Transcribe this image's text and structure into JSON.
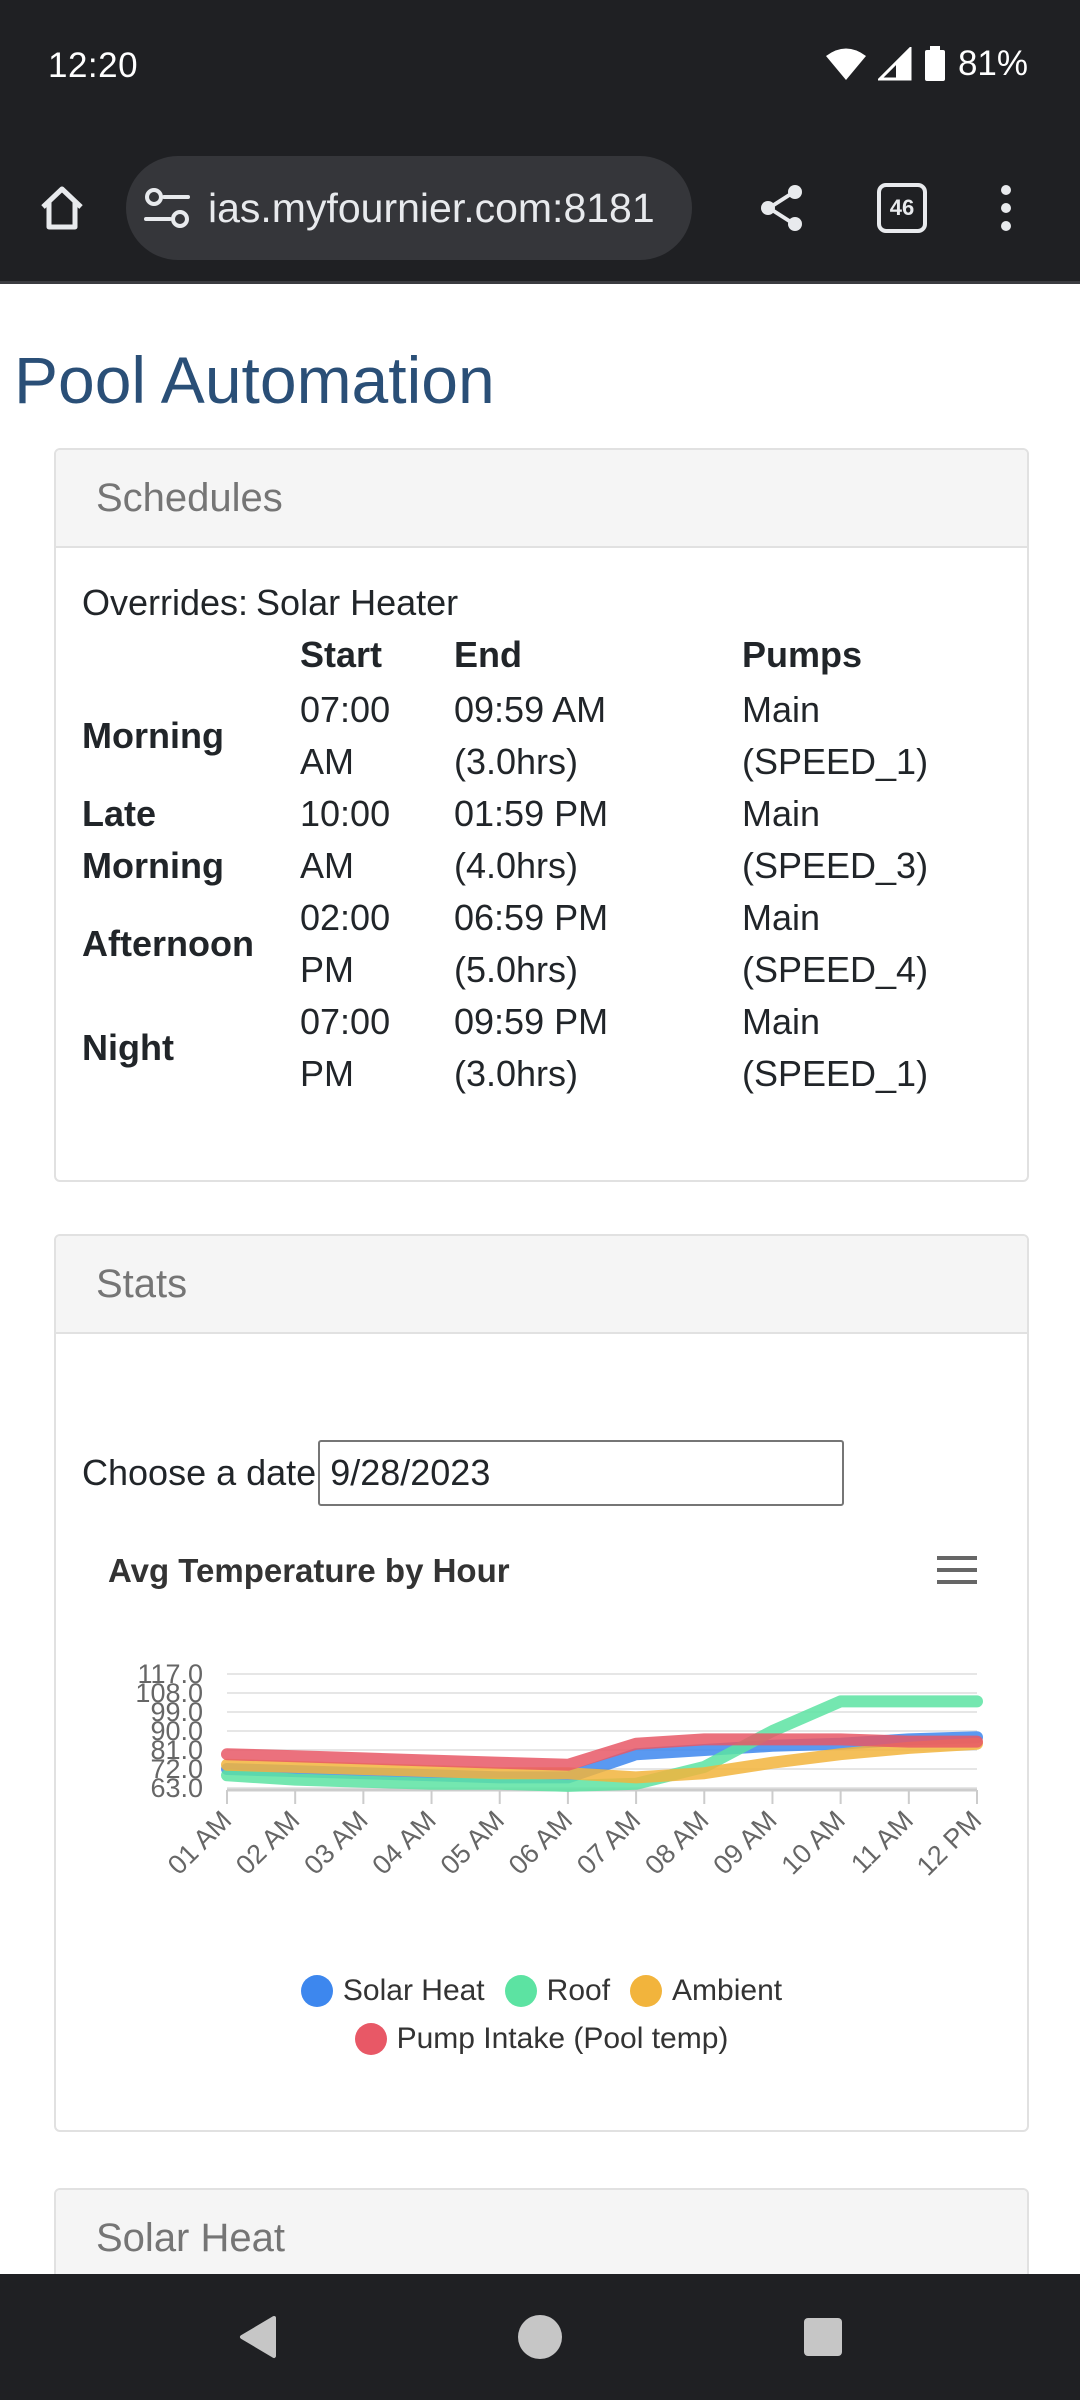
{
  "status": {
    "time": "12:20",
    "battery": "81%"
  },
  "browser": {
    "url": "ias.myfournier.com:8181",
    "tab_count": "46"
  },
  "page": {
    "title": "Pool Automation"
  },
  "schedules": {
    "header": "Schedules",
    "overrides_label": "Overrides:",
    "overrides_value": "Solar Heater",
    "columns": [
      "",
      "Start",
      "End",
      "Pumps"
    ],
    "rows": [
      {
        "name": "Morning",
        "start": [
          "07:00",
          "AM"
        ],
        "end": [
          "09:59 AM",
          "(3.0hrs)"
        ],
        "pumps": [
          "Main",
          "(SPEED_1)"
        ]
      },
      {
        "name": [
          "Late",
          "Morning"
        ],
        "start": [
          "10:00",
          "AM"
        ],
        "end": [
          "01:59 PM",
          "(4.0hrs)"
        ],
        "pumps": [
          "Main",
          "(SPEED_3)"
        ]
      },
      {
        "name": "Afternoon",
        "start": [
          "02:00",
          "PM"
        ],
        "end": [
          "06:59 PM",
          "(5.0hrs)"
        ],
        "pumps": [
          "Main",
          "(SPEED_4)"
        ]
      },
      {
        "name": "Night",
        "start": [
          "07:00",
          "PM"
        ],
        "end": [
          "09:59 PM",
          "(3.0hrs)"
        ],
        "pumps": [
          "Main",
          "(SPEED_1)"
        ]
      }
    ]
  },
  "stats": {
    "header": "Stats",
    "date_label": "Choose a date",
    "date_value": "9/28/2023"
  },
  "chart_data": {
    "type": "line",
    "title": "Avg Temperature by Hour",
    "xlabel": "",
    "ylabel": "",
    "categories": [
      "01 AM",
      "02 AM",
      "03 AM",
      "04 AM",
      "05 AM",
      "06 AM",
      "07 AM",
      "08 AM",
      "09 AM",
      "10 AM",
      "11 AM",
      "12 PM"
    ],
    "y_ticks": [
      "63.0",
      "72.0",
      "81.0",
      "90.0",
      "99.0",
      "108.0",
      "117.0"
    ],
    "ylim": [
      63,
      117
    ],
    "grid": true,
    "legend_position": "bottom",
    "series": [
      {
        "name": "Solar Heat",
        "color": "#3d87ee",
        "values": [
          72,
          71,
          70,
          69,
          68,
          68,
          79,
          81,
          83,
          84,
          86,
          87
        ]
      },
      {
        "name": "Roof",
        "color": "#5ce3a2",
        "values": [
          69,
          67,
          66,
          65,
          65,
          64,
          65,
          73,
          90,
          104,
          104,
          104
        ]
      },
      {
        "name": "Ambient",
        "color": "#f2b43c",
        "values": [
          74,
          73,
          72,
          71,
          70,
          70,
          68,
          70,
          75,
          79,
          82,
          84
        ]
      },
      {
        "name": "Pump Intake (Pool temp)",
        "color": "#e85866",
        "values": [
          79,
          78,
          77,
          76,
          75,
          74,
          84,
          86,
          86,
          86,
          85,
          85
        ]
      }
    ]
  },
  "solar_heat": {
    "header": "Solar Heat"
  },
  "icons": {
    "home": "home-icon",
    "tune": "tune-icon",
    "share": "share-icon",
    "tabs": "tab-switcher-icon",
    "menu": "more-vert-icon",
    "chart_menu": "hamburger-icon",
    "nav_back": "back-icon",
    "nav_home": "home-circle-icon",
    "nav_recents": "recents-icon"
  },
  "colors": {
    "title": "#2a4f77",
    "chrome": "#1f2023"
  }
}
